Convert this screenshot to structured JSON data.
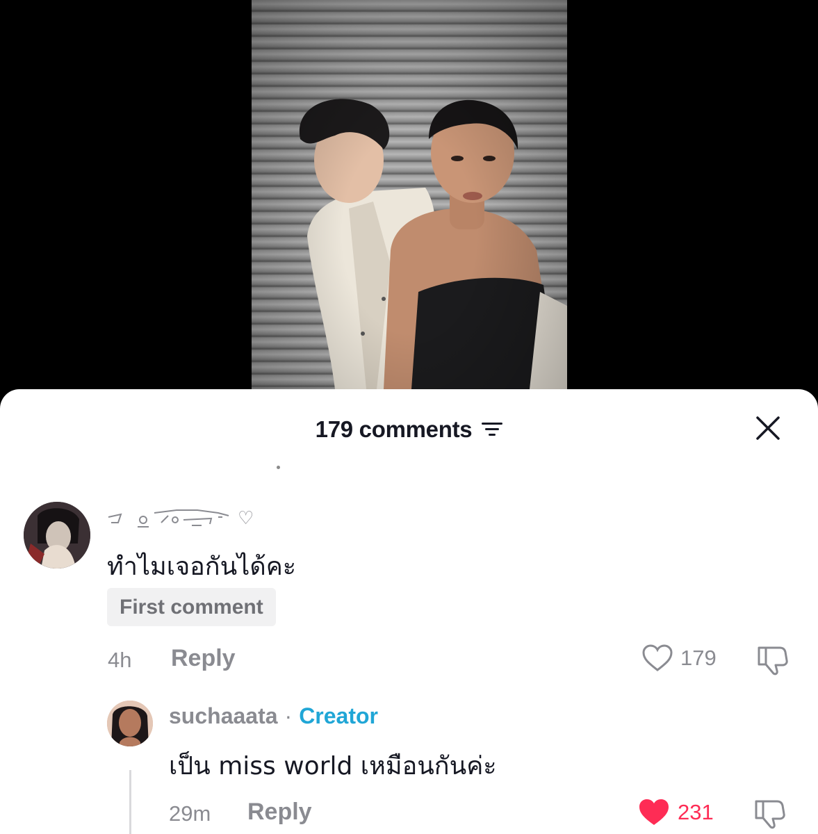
{
  "video": {
    "description_icon": "video-frame"
  },
  "sheet": {
    "title": "179 comments",
    "filter_icon": "filter-icon",
    "close_icon": "close-icon"
  },
  "comments": [
    {
      "avatar_icon": "avatar",
      "username_glyph": "decorative-symbol-username",
      "username_suffix": "♡",
      "text": "ทำไมเจอกันได้คะ",
      "badge": "First comment",
      "time": "4h",
      "reply_label": "Reply",
      "likes": "179",
      "liked": false
    }
  ],
  "replies": [
    {
      "avatar_icon": "avatar",
      "username": "suchaaata",
      "separator": "·",
      "role": "Creator",
      "text": "เป็น miss world เหมือนกันค่ะ",
      "time": "29m",
      "reply_label": "Reply",
      "likes": "231",
      "liked": true
    }
  ],
  "colors": {
    "text": "#161823",
    "muted": "#8a8b91",
    "creator": "#20a6d6",
    "like_active": "#fe2c55",
    "badge_bg": "#f1f1f2"
  }
}
